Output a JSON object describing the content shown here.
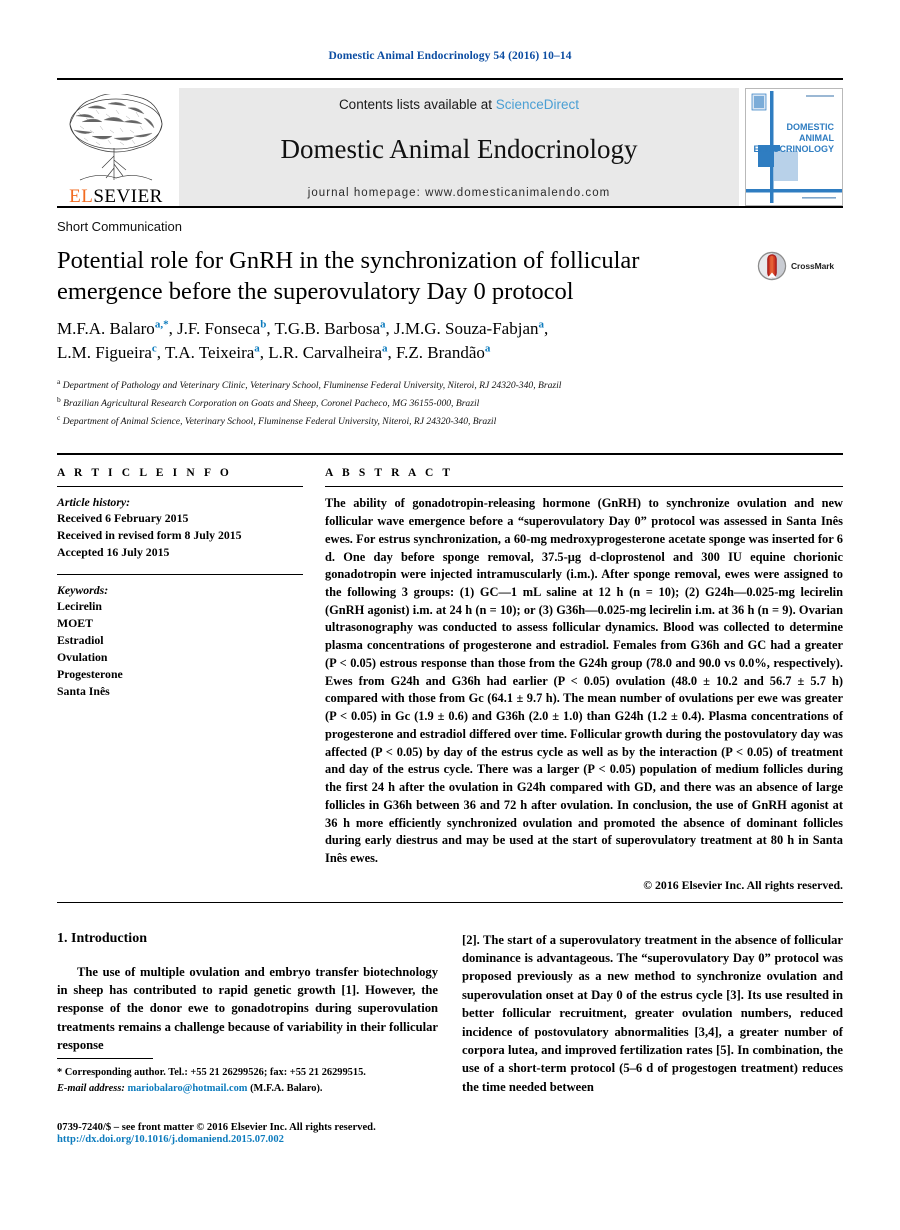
{
  "running_head": "Domestic Animal Endocrinology 54 (2016) 10–14",
  "masthead": {
    "contents_prefix": "Contents lists available at ",
    "sciencedirect": "ScienceDirect",
    "journal_name": "Domestic Animal Endocrinology",
    "homepage": "journal homepage: www.domesticanimalendo.com",
    "publisher": "ELSEVIER",
    "publisher_first_letters": "ELSEVIER",
    "cover_title_lines": [
      "DOMESTIC",
      "ANIMAL",
      "ENDOCRINOLOGY"
    ],
    "accent_blue": "#4a9fd4",
    "publisher_orange": "#f26b21"
  },
  "article": {
    "section_type": "Short Communication",
    "title": "Potential role for GnRH in the synchronization of follicular emergence before the superovulatory Day 0 protocol",
    "crossmark_label": "CrossMark",
    "authors_line1": "M.F.A. Balaro a,*, J.F. Fonseca b, T.G.B. Barbosa a, J.M.G. Souza-Fabjan a,",
    "authors_line2": "L.M. Figueira c, T.A. Teixeira a, L.R. Carvalheira a, F.Z. Brandão a",
    "authors": [
      {
        "name": "M.F.A. Balaro",
        "sup": "a,*"
      },
      {
        "name": "J.F. Fonseca",
        "sup": "b"
      },
      {
        "name": "T.G.B. Barbosa",
        "sup": "a"
      },
      {
        "name": "J.M.G. Souza-Fabjan",
        "sup": "a"
      },
      {
        "name": "L.M. Figueira",
        "sup": "c"
      },
      {
        "name": "T.A. Teixeira",
        "sup": "a"
      },
      {
        "name": "L.R. Carvalheira",
        "sup": "a"
      },
      {
        "name": "F.Z. Brandão",
        "sup": "a"
      }
    ],
    "affiliations": [
      {
        "marker": "a",
        "text": "Department of Pathology and Veterinary Clinic, Veterinary School, Fluminense Federal University, Niteroi, RJ 24320-340, Brazil"
      },
      {
        "marker": "b",
        "text": "Brazilian Agricultural Research Corporation on Goats and Sheep, Coronel Pacheco, MG 36155-000, Brazil"
      },
      {
        "marker": "c",
        "text": "Department of Animal Science, Veterinary School, Fluminense Federal University, Niteroi, RJ 24320-340, Brazil"
      }
    ]
  },
  "article_info": {
    "heading": "A R T I C L E   I N F O",
    "history_label": "Article history:",
    "history": [
      "Received 6 February 2015",
      "Received in revised form 8 July 2015",
      "Accepted 16 July 2015"
    ],
    "keywords_label": "Keywords:",
    "keywords": [
      "Lecirelin",
      "MOET",
      "Estradiol",
      "Ovulation",
      "Progesterone",
      "Santa Inês"
    ]
  },
  "abstract": {
    "heading": "A B S T R A C T",
    "text": "The ability of gonadotropin-releasing hormone (GnRH) to synchronize ovulation and new follicular wave emergence before a “superovulatory Day 0” protocol was assessed in Santa Inês ewes. For estrus synchronization, a 60-mg medroxyprogesterone acetate sponge was inserted for 6 d. One day before sponge removal, 37.5-µg d-cloprostenol and 300 IU equine chorionic gonadotropin were injected intramuscularly (i.m.). After sponge removal, ewes were assigned to the following 3 groups: (1) GC—1 mL saline at 12 h (n = 10); (2) G24h—0.025-mg lecirelin (GnRH agonist) i.m. at 24 h (n = 10); or (3) G36h—0.025-mg lecirelin i.m. at 36 h (n = 9). Ovarian ultrasonography was conducted to assess follicular dynamics. Blood was collected to determine plasma concentrations of progesterone and estradiol. Females from G36h and GC had a greater (P < 0.05) estrous response than those from the G24h group (78.0 and 90.0 vs 0.0%, respectively). Ewes from G24h and G36h had earlier (P < 0.05) ovulation (48.0 ± 10.2 and 56.7 ± 5.7 h) compared with those from Gc (64.1 ± 9.7 h). The mean number of ovulations per ewe was greater (P < 0.05) in Gc (1.9 ± 0.6) and G36h (2.0 ± 1.0) than G24h (1.2 ± 0.4). Plasma concentrations of progesterone and estradiol differed over time. Follicular growth during the postovulatory day was affected (P < 0.05) by day of the estrus cycle as well as by the interaction (P < 0.05) of treatment and day of the estrus cycle. There was a larger (P < 0.05) population of medium follicles during the first 24 h after the ovulation in G24h compared with GD, and there was an absence of large follicles in G36h between 36 and 72 h after ovulation. In conclusion, the use of GnRH agonist at 36 h more efficiently synchronized ovulation and promoted the absence of dominant follicles during early diestrus and may be used at the start of superovulatory treatment at 80 h in Santa Inês ewes.",
    "copyright": "© 2016 Elsevier Inc. All rights reserved."
  },
  "introduction": {
    "heading": "1. Introduction",
    "left_paragraph": "The use of multiple ovulation and embryo transfer biotechnology in sheep has contributed to rapid genetic growth [1]. However, the response of the donor ewe to gonadotropins during superovulation treatments remains a challenge because of variability in their follicular response",
    "right_paragraph": "[2]. The start of a superovulatory treatment in the absence of follicular dominance is advantageous. The “superovulatory Day 0” protocol was proposed previously as a new method to synchronize ovulation and superovulation onset at Day 0 of the estrus cycle [3]. Its use resulted in better follicular recruitment, greater ovulation numbers, reduced incidence of postovulatory abnormalities [3,4], a greater number of corpora lutea, and improved fertilization rates [5]. In combination, the use of a short-term protocol (5–6 d of progestogen treatment) reduces the time needed between"
  },
  "footnotes": {
    "corresponding": "* Corresponding author. Tel.: +55 21 26299526; fax: +55 21 26299515.",
    "email_label": "E-mail address:",
    "email": "mariobalaro@hotmail.com",
    "email_owner": "(M.F.A. Balaro)."
  },
  "footer": {
    "issn_line": "0739-7240/$ – see front matter © 2016 Elsevier Inc. All rights reserved.",
    "doi_line": "http://dx.doi.org/10.1016/j.domaniend.2015.07.002"
  }
}
